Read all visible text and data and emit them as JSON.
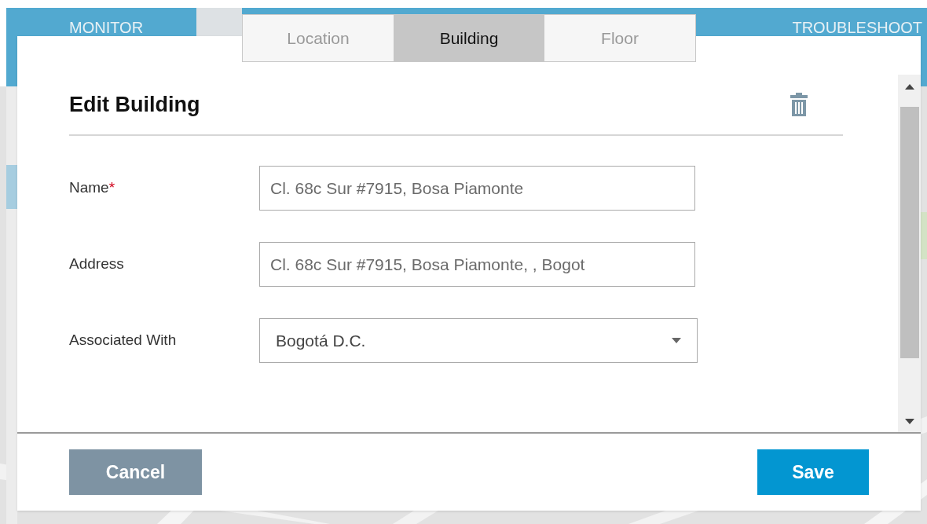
{
  "background": {
    "nav": [
      {
        "label": "MONITOR",
        "selected": true
      },
      {
        "label": "TROUBLESHOOT",
        "selected": true
      }
    ]
  },
  "tabs": [
    {
      "label": "Location",
      "selected": false
    },
    {
      "label": "Building",
      "selected": true
    },
    {
      "label": "Floor",
      "selected": false
    }
  ],
  "dialog": {
    "title": "Edit Building",
    "fields": [
      {
        "kind": "text",
        "label": "Name",
        "required_mark": "*",
        "value": "Cl. 68c Sur #7915, Bosa Piamonte"
      },
      {
        "kind": "text",
        "label": "Address",
        "value": "Cl. 68c Sur #7915, Bosa Piamonte, , Bogot"
      },
      {
        "kind": "select",
        "label": "Associated With",
        "value": "Bogotá D.C."
      }
    ],
    "buttons": [
      {
        "label": "Cancel",
        "kind": "secondary"
      },
      {
        "label": "Save",
        "kind": "primary"
      }
    ]
  }
}
